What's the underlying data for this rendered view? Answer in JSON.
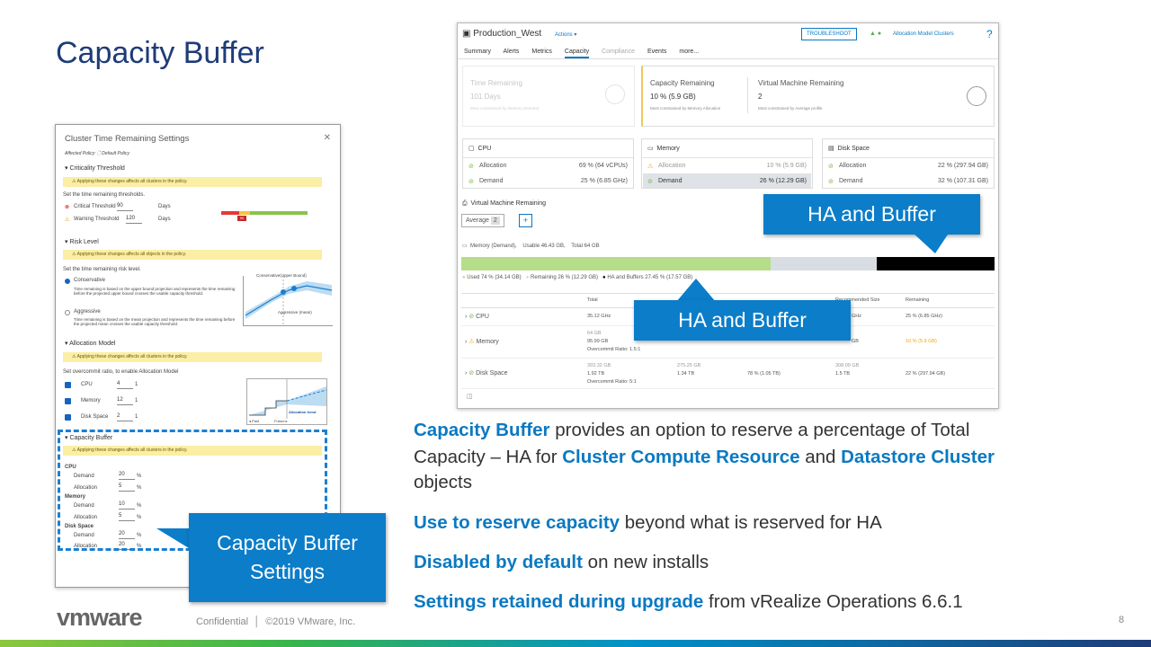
{
  "slide": {
    "title": "Capacity Buffer",
    "page_number": "8",
    "footer": "Confidential  │  ©2019 VMware, Inc.",
    "logo": "vmware"
  },
  "dialog": {
    "title": "Cluster Time Remaining Settings",
    "affected_policy": "Affected Policy: 🗋 Default Policy",
    "criticality_heading": "Criticality Threshold",
    "warn_clusters": "Applying these changes affects all clusters in the policy.",
    "set_time_label": "Set the time remaining thresholds.",
    "critical_label": "Critical Threshold",
    "critical_value": "90",
    "warning_label": "Warning Threshold",
    "warning_value": "120",
    "days": "Days",
    "risk_heading": "Risk Level",
    "warn_objects": "Applying these changes affects all objects in the policy.",
    "risk_label": "Set the time remaining risk level.",
    "conservative": "Conservative",
    "conservative_desc": "Time remaining is based on the upper bound projection and represents the time remaining before the projected upper bound crosses the usable capacity threshold.",
    "aggressive": "Aggressive",
    "aggressive_desc": "Time remaining is based on the mean projection and represents the time remaining before the projected mean crosses the usable capacity threshold.",
    "conservative_chart_label": "Conservative(Upper Bound)",
    "aggressive_chart_label": "Aggressive (mean)",
    "alloc_heading": "Allocation Model",
    "alloc_label": "Set overcommit ratio, to enable Allocation Model",
    "cpu": "CPU",
    "cpu_ratio": "4",
    "memory": "Memory",
    "memory_ratio": "12",
    "disk": "Disk Space",
    "disk_ratio": "2",
    "one": "1",
    "alloc_trend": "Allocation trend",
    "usable_capacity": "Usable Capacity",
    "past": "◂ Past",
    "future": "Future ▸",
    "buffer_heading": "Capacity Buffer",
    "demand": "Demand",
    "allocation": "Allocation",
    "buf_cpu_demand": "20",
    "buf_cpu_alloc": "5",
    "buf_mem_demand": "10",
    "buf_mem_alloc": "5",
    "buf_disk_demand": "20",
    "buf_disk_alloc": "20",
    "pct": "%"
  },
  "callouts": {
    "buffer_settings_1": "Capacity Buffer",
    "buffer_settings_2": "Settings",
    "ha_top": "HA and Buffer",
    "ha_bottom": "HA and Buffer"
  },
  "vrops": {
    "object": "Production_West",
    "actions": "Actions ▾",
    "troubleshoot": "TROUBLESHOOT",
    "alloc_clusters": "Allocation Model Clusters",
    "help": "?",
    "tabs": [
      "Summary",
      "Alerts",
      "Metrics",
      "Capacity",
      "Compliance",
      "Events",
      "more..."
    ],
    "time_remaining_label": "Time Remaining",
    "time_remaining_value": "101 Days",
    "time_remaining_note": "Most constrained by Memory Demand",
    "cap_remaining_label": "Capacity Remaining",
    "cap_remaining_value": "10 % (5.9 GB)",
    "cap_remaining_note": "Most constrained by Memory Allocation",
    "vm_remaining_label": "Virtual Machine Remaining",
    "vm_remaining_value": "2",
    "vm_remaining_note": "Most constrained by Average profile",
    "cards": [
      {
        "name": "CPU",
        "alloc": "69 % (64 vCPUs)",
        "demand": "25 % (6.85 GHz)"
      },
      {
        "name": "Memory",
        "alloc": "10 % (5.9 GB)",
        "demand": "26 % (12.29 GB)"
      },
      {
        "name": "Disk Space",
        "alloc": "22 % (297.94 GB)",
        "demand": "32 % (107.31 GB)"
      }
    ],
    "allocation": "Allocation",
    "demand": "Demand",
    "vmr_title": "Virtual Machine Remaining",
    "average": "Average",
    "average_count": "2",
    "plus": "+",
    "mem_line": "Memory (Demand),    Usable 46.43 GB,    Total 64 GB",
    "legend_used": "Used 74 % (34.14 GB)",
    "legend_remaining": "Remaining 26 % (12.29 GB)",
    "legend_ha": "HA and Buffers 27.45 % (17.57 GB)",
    "col_total": "Total",
    "col_recommended": "Recommended Size",
    "col_remaining": "Remaining",
    "row_cpu": {
      "name": "CPU",
      "total": "35.12 GHz",
      "rec": "GHz",
      "remaining": "25 % (6.85 GHz)"
    },
    "row_mem": {
      "name": "Memory",
      "total_a": "64 GB",
      "total_b": "95.99 GB",
      "ratio": "Overcommit Ratio: 1.5:1",
      "rec": "GB",
      "remaining": "10 % (5.9 GB)"
    },
    "row_disk": {
      "name": "Disk Space",
      "total_a": "393.32 GB",
      "total_b": "1.92 TB",
      "ratio": "Overcommit Ratio: 5:1",
      "c2a": "275.25 GB",
      "c2b": "1.34 TB",
      "c3": "78 % (1.05 TB)",
      "rec_a": "308.09 GB",
      "rec_b": "1.5 TB",
      "remaining": "22 % (297.94 GB)"
    },
    "colors": {
      "used": "#b5dd8a",
      "remaining": "#d7dde3",
      "ha": "#000000",
      "warning": "#f0a30a",
      "accent": "#0a79c2"
    }
  },
  "bullets": [
    {
      "hl": "Capacity Buffer",
      "rest": " provides an option to reserve a percentage of Total"
    },
    {
      "line2a": "Capacity – HA for ",
      "hl2": "Cluster Compute Resource",
      "line2b": " and ",
      "hl3": "Datastore Cluster"
    },
    {
      "line3": "objects"
    },
    {
      "hl": "Use to reserve capacity",
      "rest": " beyond what is reserved for HA"
    },
    {
      "hl": "Disabled by default",
      "rest": " on new installs"
    },
    {
      "hl": "Settings retained during upgrade",
      "rest": " from vRealize Operations 6.6.1"
    }
  ]
}
